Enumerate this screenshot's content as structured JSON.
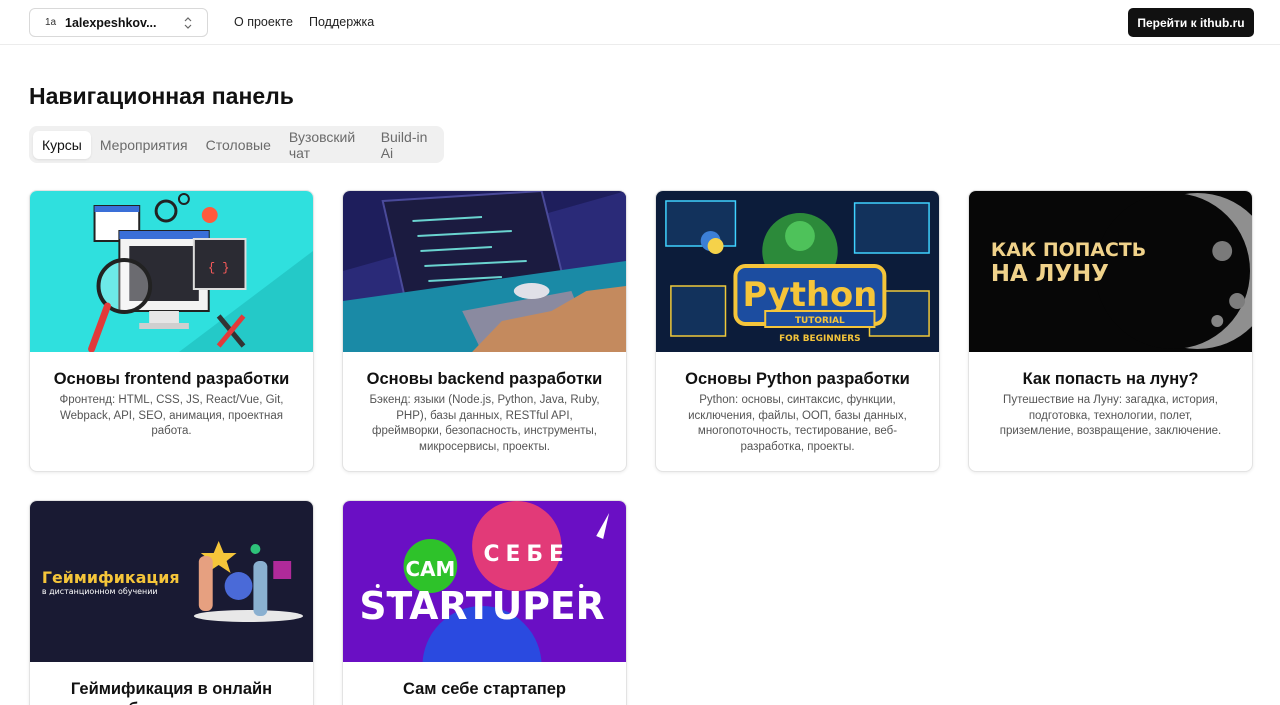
{
  "header": {
    "account_initials": "1a",
    "account_name": "1alexpeshkov...",
    "links": [
      "О проекте",
      "Поддержка"
    ],
    "cta_label": "Перейти к ithub.ru"
  },
  "page": {
    "title": "Навигационная панель"
  },
  "tabs": [
    "Курсы",
    "Мероприятия",
    "Столовые",
    "Вузовский чат",
    "Build-in Ai"
  ],
  "active_tab": "Курсы",
  "cards": [
    {
      "title": "Основы frontend разработки",
      "description": "Фронтенд: HTML, CSS, JS, React/Vue, Git, Webpack, API, SEO, анимация, проектная работа."
    },
    {
      "title": "Основы backend разработки",
      "description": "Бэкенд: языки (Node.js, Python, Java, Ruby, PHP), базы данных, RESTful API, фреймворки, безопасность, инструменты, микросервисы, проекты."
    },
    {
      "title": "Основы Python разработки",
      "description": "Python: основы, синтаксис, функции, исключения, файлы, ООП, базы данных, многопоточность, тестирование, веб-разработка, проекты.",
      "image_text": [
        "Python",
        "TUTORIAL",
        "FOR BEGINNERS"
      ]
    },
    {
      "title": "Как попасть на луну?",
      "description": "Путешествие на Луну: загадка, история, подготовка, технологии, полет, приземление, возвращение, заключение.",
      "image_text": [
        "КАК ПОПАСТЬ",
        "НА ЛУНУ"
      ]
    },
    {
      "title": "Геймификация в онлайн образовании",
      "description": "",
      "image_text": [
        "Геймификация",
        "в дистанционном обучении"
      ]
    },
    {
      "title": "Сам себе стартапер",
      "description": "",
      "image_text": [
        "САМ",
        "СЕБЕ",
        "STARTUPER"
      ]
    }
  ]
}
